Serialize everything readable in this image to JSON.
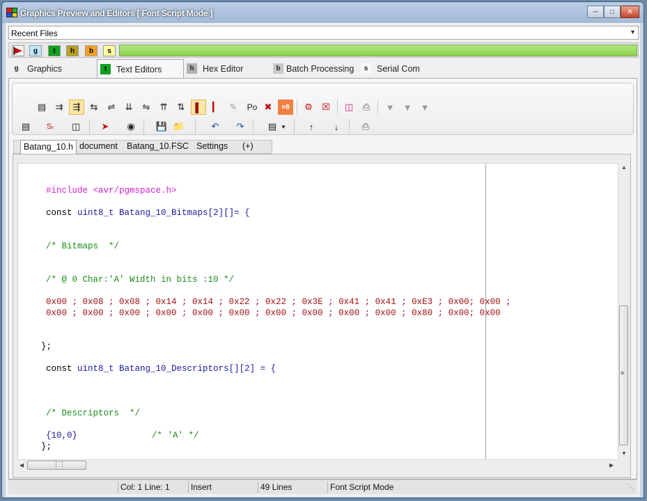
{
  "window": {
    "title": "Graphics Preview and Editors [ Font Script Mode ]"
  },
  "recent_files": {
    "label": "Recent Files"
  },
  "colorbar": [
    {
      "letter": "g",
      "color": "#bfe8ff"
    },
    {
      "letter": "t",
      "color": "#10a020"
    },
    {
      "letter": "h",
      "color": "#b8a020"
    },
    {
      "letter": "b",
      "color": "#f5a020"
    },
    {
      "letter": "s",
      "color": "#ffffa0"
    }
  ],
  "main_tabs": [
    {
      "icon": "g",
      "label": "Graphics"
    },
    {
      "icon": "t",
      "label": "Text Editors"
    },
    {
      "icon": "h",
      "label": "Hex Editor"
    },
    {
      "icon": "b",
      "label": "Batch Processing"
    },
    {
      "icon": "s",
      "label": "Serial Com"
    }
  ],
  "toolbar": {
    "po_label": "Po",
    "x8_label": "×8"
  },
  "doc_tabs": [
    "Batang_10.h",
    "document",
    "Batang_10.FSC",
    "Settings",
    "(+)"
  ],
  "code": {
    "include": "#include <avr/pgmspace.h>",
    "bitmaps_decl_kw": "const",
    "bitmaps_decl_rest": "uint8_t Batang_10_Bitmaps[2][]= {",
    "bitmaps_comment": "/* Bitmaps  */",
    "char_comment": "/* @ 0 Char:'A' Width in bits :10 */",
    "row1": "0x00 ; 0x08 ; 0x08 ; 0x14 ; 0x14 ; 0x22 ; 0x22 ; 0x3E ; 0x41 ; 0x41 ; 0xE3 ; 0x00; 0x00 ;",
    "row2": "0x00 ; 0x00 ; 0x00 ; 0x00 ; 0x00 ; 0x00 ; 0x00 ; 0x00 ; 0x00 ; 0x00 ; 0x80 ; 0x00; 0x00",
    "close1": "};",
    "desc_decl_kw": "const",
    "desc_decl_rest": "uint8_t Batang_10_Descriptors[][2] = {",
    "desc_comment": "/* Descriptors  */",
    "desc_value": "{10,0}",
    "desc_value_comment": "/* 'A' */",
    "close2": "};"
  },
  "status": {
    "position": "Col: 1 Line: 1",
    "mode": "Insert",
    "lines": "49 Lines",
    "script_mode": "Font Script Mode"
  }
}
